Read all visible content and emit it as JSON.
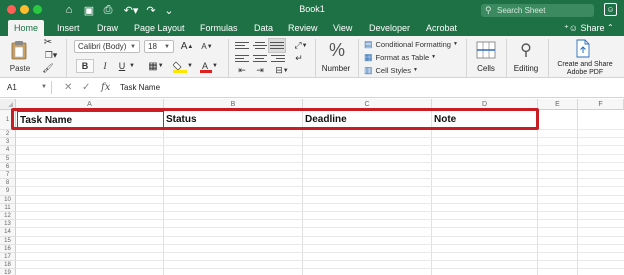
{
  "window": {
    "title": "Book1",
    "search_placeholder": "Search Sheet",
    "share_label": "Share"
  },
  "tabs": [
    "Home",
    "Insert",
    "Draw",
    "Page Layout",
    "Formulas",
    "Data",
    "Review",
    "View",
    "Developer",
    "Acrobat"
  ],
  "ribbon": {
    "paste_label": "Paste",
    "font_name": "Calibri (Body)",
    "font_size": "18",
    "bold_label": "B",
    "italic_label": "I",
    "underline_label": "U",
    "grow_font_label": "A",
    "shrink_font_label": "A",
    "number_label": "Number",
    "percent_symbol": "%",
    "conditional_formatting_label": "Conditional Formatting",
    "format_as_table_label": "Format as Table",
    "cell_styles_label": "Cell Styles",
    "cells_label": "Cells",
    "editing_label": "Editing",
    "adobe_label_line1": "Create and Share",
    "adobe_label_line2": "Adobe PDF"
  },
  "formula_bar": {
    "name_box": "A1",
    "fx_label": "fx",
    "content": "Task Name"
  },
  "sheet": {
    "columns": [
      "A",
      "B",
      "C",
      "D",
      "E",
      "F"
    ],
    "rows": [
      "1",
      "2",
      "3",
      "4",
      "5",
      "6",
      "7",
      "8",
      "9",
      "10",
      "11",
      "12",
      "13",
      "14",
      "15",
      "16",
      "17",
      "18",
      "19"
    ],
    "header_cells": [
      "Task Name",
      "Status",
      "Deadline",
      "Note"
    ]
  },
  "colors": {
    "accent": "#1e7145",
    "highlight": "#c81d22",
    "font_color_bar": "#e0201c",
    "fill_color_bar": "#ffe600"
  }
}
